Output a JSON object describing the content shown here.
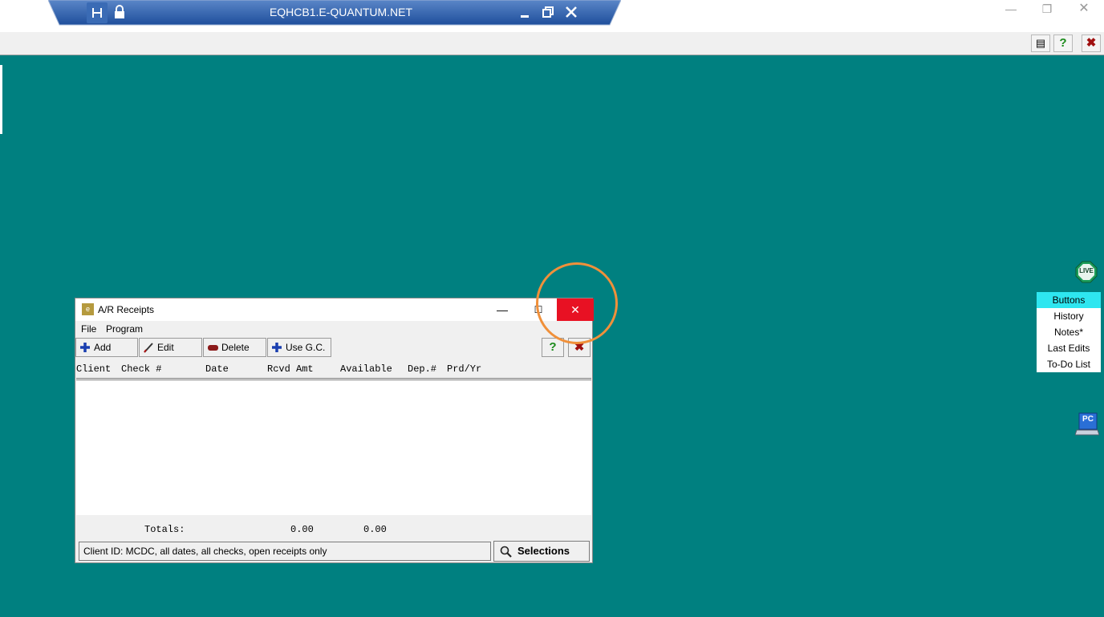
{
  "rdp_bar": {
    "title": "EQHCB1.E-QUANTUM.NET",
    "pin_icon": "pin-icon",
    "lock_icon": "lock-icon",
    "minimize": "‒",
    "restore": "❐",
    "close": "✕"
  },
  "host_controls": {
    "minimize": "—",
    "restore": "❐",
    "close": "✕"
  },
  "app_strip": {
    "buttons": [
      {
        "icon": "document-icon",
        "glyph": "▤"
      },
      {
        "icon": "help-icon",
        "glyph": "?"
      },
      {
        "icon": "close-icon",
        "glyph": "✖"
      }
    ]
  },
  "ar_window": {
    "title": "A/R Receipts",
    "app_icon_text": "e",
    "controls": {
      "minimize": "—",
      "maximize": "☐",
      "close": "✕"
    },
    "menu": [
      "File",
      "Program"
    ],
    "toolbar": {
      "add": "Add",
      "edit": "Edit",
      "delete": "Delete",
      "use_gc": "Use G.C.",
      "help": "?",
      "close": "✖"
    },
    "columns": [
      "Client",
      "Check #",
      "Date",
      "Rcvd Amt",
      "Available",
      "Dep.#",
      "Prd/Yr"
    ],
    "rows": [],
    "totals": {
      "label": "Totals:",
      "rcvd": "0.00",
      "available": "0.00"
    },
    "status": "Client ID: MCDC, all dates, all checks, open receipts only",
    "selections_label": "Selections"
  },
  "live_badge": "LIVE",
  "side_panel": {
    "items": [
      "Buttons",
      "History",
      "Notes*",
      "Last Edits",
      "To-Do List"
    ],
    "active": "Buttons"
  },
  "pc_icon_text": "PC",
  "colors": {
    "desktop": "#008080",
    "rdp_bar": "#2f5ea8",
    "close_red": "#e81123",
    "highlight": "#f0903a",
    "side_active": "#2ee6f0"
  }
}
